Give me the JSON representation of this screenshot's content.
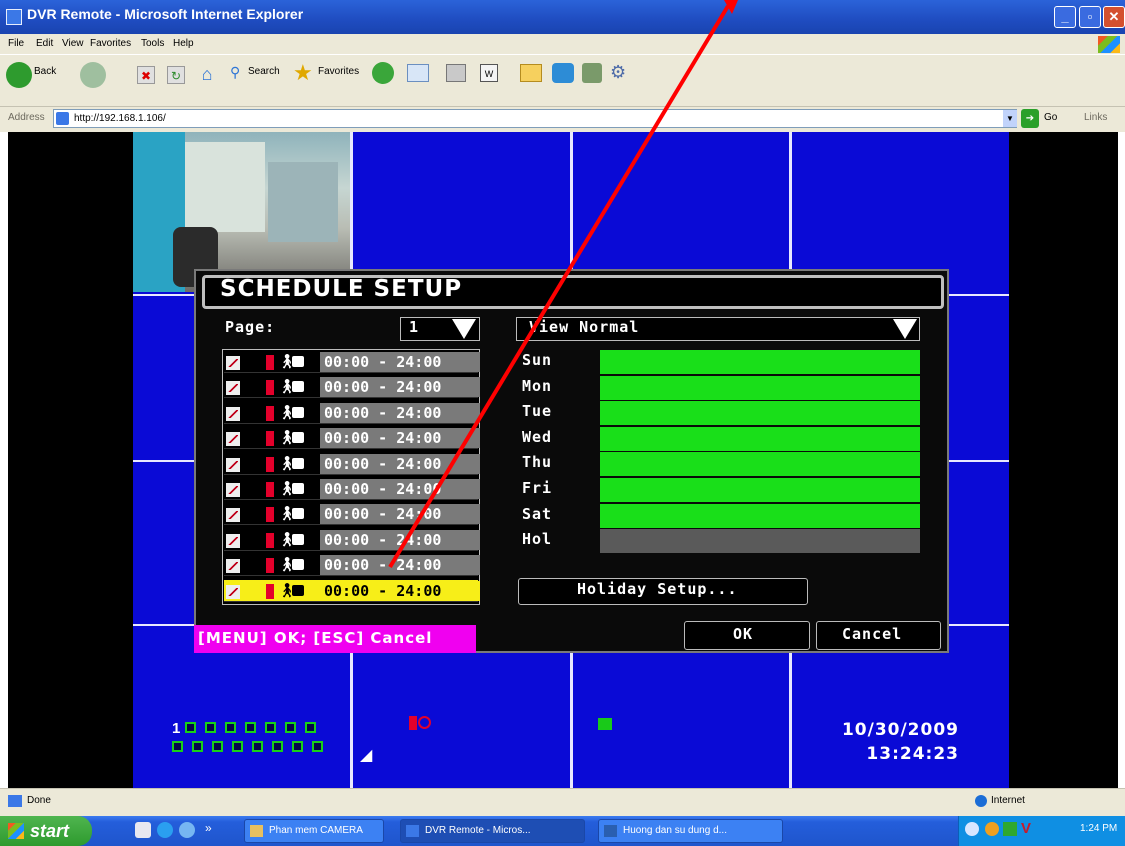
{
  "window": {
    "title": "DVR Remote - Microsoft Internet Explorer"
  },
  "menu": [
    "File",
    "Edit",
    "View",
    "Favorites",
    "Tools",
    "Help"
  ],
  "toolbar": {
    "back": "Back",
    "search": "Search",
    "favorites": "Favorites"
  },
  "address": {
    "label": "Address",
    "url": "http://192.168.1.106/",
    "go": "Go",
    "links": "Links"
  },
  "dialog": {
    "title": "SCHEDULE SETUP",
    "page_label": "Page:",
    "page_value": "1",
    "view_value": "View Normal",
    "schedule_rows": [
      "00:00 - 24:00",
      "00:00 - 24:00",
      "00:00 - 24:00",
      "00:00 - 24:00",
      "00:00 - 24:00",
      "00:00 - 24:00",
      "00:00 - 24:00",
      "00:00 - 24:00",
      "00:00 - 24:00",
      "00:00 - 24:00"
    ],
    "selected_row": 9,
    "days": [
      "Sun",
      "Mon",
      "Tue",
      "Wed",
      "Thu",
      "Fri",
      "Sat",
      "Hol"
    ],
    "holiday_button": "Holiday Setup...",
    "hint": "[MENU] OK; [ESC] Cancel",
    "ok": "OK",
    "cancel": "Cancel"
  },
  "dvr_status": {
    "channel": "1",
    "date": "10/30/2009",
    "time": "13:24:23"
  },
  "statusbar": {
    "text": "Done",
    "zone": "Internet"
  },
  "taskbar": {
    "start": "start",
    "tasks": [
      "Phan mem CAMERA",
      "DVR Remote - Micros...",
      "Huong dan su dung d..."
    ],
    "clock": "1:24 PM"
  },
  "colors": {
    "dvr_bg": "#0a0ad6",
    "bar_on": "#19df19",
    "bar_off": "#5a5a5a",
    "selected": "#f7ee18",
    "hint_bg": "#f000f0",
    "annotation": "#ff0000"
  }
}
